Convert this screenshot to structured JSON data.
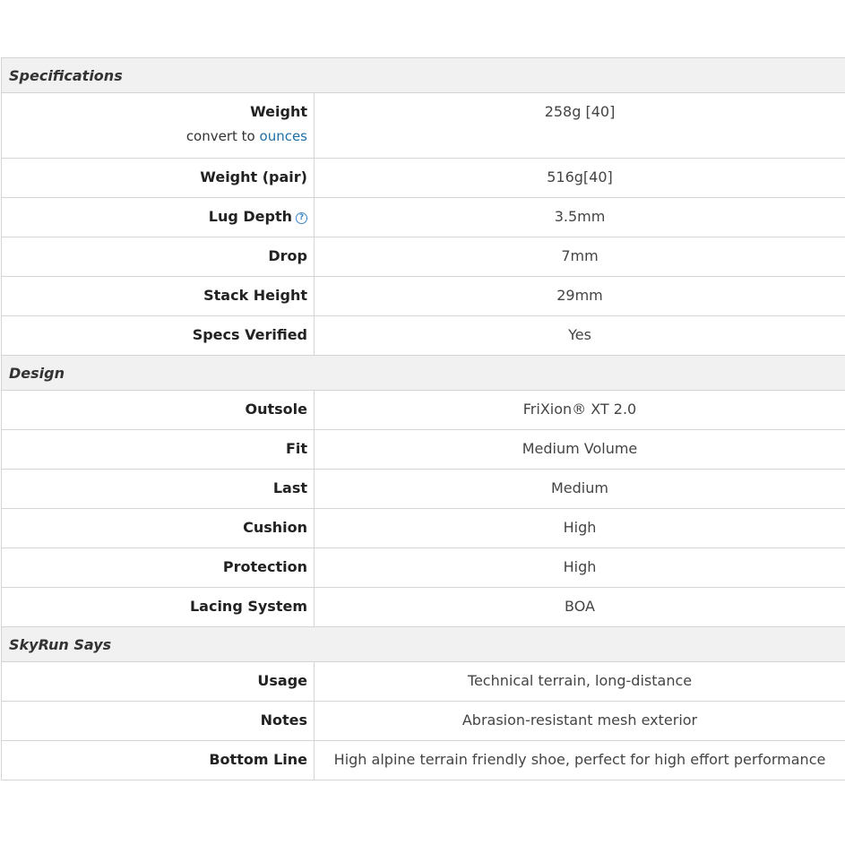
{
  "sections": [
    {
      "title": "Specifications",
      "rows": [
        {
          "label": "Weight",
          "value": "258g [40]",
          "sub_prefix": "convert to",
          "sub_link": "ounces"
        },
        {
          "label": "Weight (pair)",
          "value": "516g[40]"
        },
        {
          "label": "Lug Depth",
          "value": "3.5mm",
          "help_icon": "?"
        },
        {
          "label": "Drop",
          "value": "7mm"
        },
        {
          "label": "Stack Height",
          "value": "29mm"
        },
        {
          "label": "Specs Verified",
          "value": "Yes"
        }
      ]
    },
    {
      "title": "Design",
      "rows": [
        {
          "label": "Outsole",
          "value": "FriXion® XT 2.0"
        },
        {
          "label": "Fit",
          "value": "Medium Volume"
        },
        {
          "label": "Last",
          "value": "Medium"
        },
        {
          "label": "Cushion",
          "value": "High"
        },
        {
          "label": "Protection",
          "value": "High"
        },
        {
          "label": "Lacing System",
          "value": "BOA"
        }
      ]
    },
    {
      "title": "SkyRun Says",
      "rows": [
        {
          "label": "Usage",
          "value": "Technical terrain, long-distance"
        },
        {
          "label": "Notes",
          "value": "Abrasion-resistant mesh exterior"
        },
        {
          "label": "Bottom Line",
          "value": "High alpine terrain friendly shoe, perfect for high effort performance"
        }
      ]
    }
  ],
  "colors": {
    "link": "#1f6fa8",
    "help_icon": "#3a86c8",
    "section_bg": "#f1f1f1",
    "border": "#d4d4d4"
  }
}
